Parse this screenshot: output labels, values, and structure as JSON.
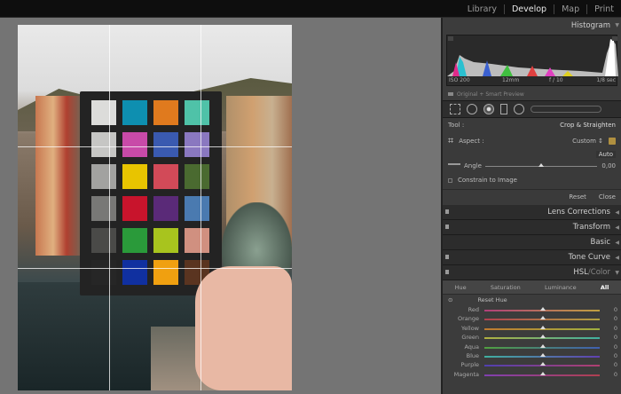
{
  "top_nav": {
    "modules": [
      "Library",
      "Develop",
      "Map",
      "Print"
    ],
    "active": "Develop"
  },
  "histogram": {
    "title": "Histogram",
    "iso": "ISO 200",
    "focal": "12mm",
    "aperture": "f / 10",
    "shutter": "1/8 sec",
    "preview": "Original + Smart Preview"
  },
  "crop": {
    "tool_label": "Tool :",
    "tool_name": "Crop & Straighten",
    "aspect_label": "Aspect :",
    "aspect_value": "Custom ↕",
    "auto_label": "Auto",
    "angle_label": "Angle",
    "angle_value": "0,00",
    "angle_position": 0.5,
    "constrain_label": "Constrain to Image",
    "reset_label": "Reset",
    "close_label": "Close"
  },
  "panels": [
    "Lens Corrections",
    "Transform",
    "Basic",
    "Tone Curve"
  ],
  "hsl": {
    "title_main": "HSL",
    "title_sep": " / ",
    "title_alt": "Color",
    "tabs": [
      "Hue",
      "Saturation",
      "Luminance",
      "All"
    ],
    "active_tab": "All",
    "reset_label": "Reset Hue",
    "rows": [
      {
        "label": "Red",
        "value": "0",
        "from": "#b0407a",
        "to": "#c0a040"
      },
      {
        "label": "Orange",
        "value": "0",
        "from": "#b04050",
        "to": "#b0a040"
      },
      {
        "label": "Yellow",
        "value": "0",
        "from": "#c07a30",
        "to": "#a0b040"
      },
      {
        "label": "Green",
        "value": "0",
        "from": "#b0b040",
        "to": "#40b0a0"
      },
      {
        "label": "Aqua",
        "value": "0",
        "from": "#50a040",
        "to": "#4060b0"
      },
      {
        "label": "Blue",
        "value": "0",
        "from": "#40b0a0",
        "to": "#6040b0"
      },
      {
        "label": "Purple",
        "value": "0",
        "from": "#5040b0",
        "to": "#b04070"
      },
      {
        "label": "Magenta",
        "value": "0",
        "from": "#8040b0",
        "to": "#b04050"
      }
    ]
  },
  "checker_colors": [
    "#dcdcda",
    "#0e8fb0",
    "#e07a1e",
    "#4fc2a8",
    "#c6c6c4",
    "#c84aa8",
    "#3a5ab0",
    "#8a78c0",
    "#a2a2a0",
    "#e8c400",
    "#d24a58",
    "#4a6a30",
    "#787876",
    "#c8142c",
    "#5a2a78",
    "#4a7ab0",
    "#4a4a48",
    "#2a9a3a",
    "#a8c41e",
    "#d09080",
    "#262626",
    "#1030a0",
    "#f0a010",
    "#5a3420"
  ]
}
